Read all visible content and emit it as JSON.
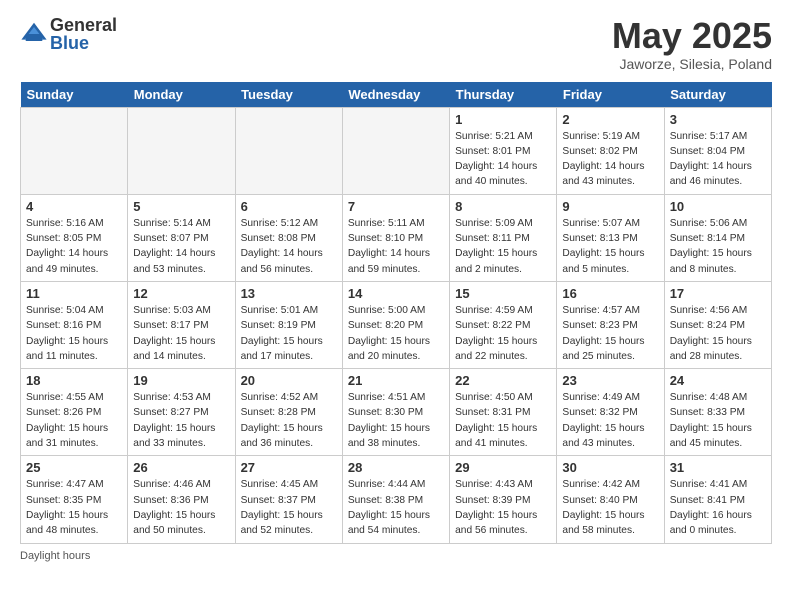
{
  "header": {
    "logo_general": "General",
    "logo_blue": "Blue",
    "month_title": "May 2025",
    "location": "Jaworze, Silesia, Poland"
  },
  "days_of_week": [
    "Sunday",
    "Monday",
    "Tuesday",
    "Wednesday",
    "Thursday",
    "Friday",
    "Saturday"
  ],
  "footer": {
    "note": "Daylight hours"
  },
  "weeks": [
    [
      {
        "day": "",
        "empty": true
      },
      {
        "day": "",
        "empty": true
      },
      {
        "day": "",
        "empty": true
      },
      {
        "day": "",
        "empty": true
      },
      {
        "day": "1",
        "sunrise": "Sunrise: 5:21 AM",
        "sunset": "Sunset: 8:01 PM",
        "daylight": "Daylight: 14 hours and 40 minutes."
      },
      {
        "day": "2",
        "sunrise": "Sunrise: 5:19 AM",
        "sunset": "Sunset: 8:02 PM",
        "daylight": "Daylight: 14 hours and 43 minutes."
      },
      {
        "day": "3",
        "sunrise": "Sunrise: 5:17 AM",
        "sunset": "Sunset: 8:04 PM",
        "daylight": "Daylight: 14 hours and 46 minutes."
      }
    ],
    [
      {
        "day": "4",
        "sunrise": "Sunrise: 5:16 AM",
        "sunset": "Sunset: 8:05 PM",
        "daylight": "Daylight: 14 hours and 49 minutes."
      },
      {
        "day": "5",
        "sunrise": "Sunrise: 5:14 AM",
        "sunset": "Sunset: 8:07 PM",
        "daylight": "Daylight: 14 hours and 53 minutes."
      },
      {
        "day": "6",
        "sunrise": "Sunrise: 5:12 AM",
        "sunset": "Sunset: 8:08 PM",
        "daylight": "Daylight: 14 hours and 56 minutes."
      },
      {
        "day": "7",
        "sunrise": "Sunrise: 5:11 AM",
        "sunset": "Sunset: 8:10 PM",
        "daylight": "Daylight: 14 hours and 59 minutes."
      },
      {
        "day": "8",
        "sunrise": "Sunrise: 5:09 AM",
        "sunset": "Sunset: 8:11 PM",
        "daylight": "Daylight: 15 hours and 2 minutes."
      },
      {
        "day": "9",
        "sunrise": "Sunrise: 5:07 AM",
        "sunset": "Sunset: 8:13 PM",
        "daylight": "Daylight: 15 hours and 5 minutes."
      },
      {
        "day": "10",
        "sunrise": "Sunrise: 5:06 AM",
        "sunset": "Sunset: 8:14 PM",
        "daylight": "Daylight: 15 hours and 8 minutes."
      }
    ],
    [
      {
        "day": "11",
        "sunrise": "Sunrise: 5:04 AM",
        "sunset": "Sunset: 8:16 PM",
        "daylight": "Daylight: 15 hours and 11 minutes."
      },
      {
        "day": "12",
        "sunrise": "Sunrise: 5:03 AM",
        "sunset": "Sunset: 8:17 PM",
        "daylight": "Daylight: 15 hours and 14 minutes."
      },
      {
        "day": "13",
        "sunrise": "Sunrise: 5:01 AM",
        "sunset": "Sunset: 8:19 PM",
        "daylight": "Daylight: 15 hours and 17 minutes."
      },
      {
        "day": "14",
        "sunrise": "Sunrise: 5:00 AM",
        "sunset": "Sunset: 8:20 PM",
        "daylight": "Daylight: 15 hours and 20 minutes."
      },
      {
        "day": "15",
        "sunrise": "Sunrise: 4:59 AM",
        "sunset": "Sunset: 8:22 PM",
        "daylight": "Daylight: 15 hours and 22 minutes."
      },
      {
        "day": "16",
        "sunrise": "Sunrise: 4:57 AM",
        "sunset": "Sunset: 8:23 PM",
        "daylight": "Daylight: 15 hours and 25 minutes."
      },
      {
        "day": "17",
        "sunrise": "Sunrise: 4:56 AM",
        "sunset": "Sunset: 8:24 PM",
        "daylight": "Daylight: 15 hours and 28 minutes."
      }
    ],
    [
      {
        "day": "18",
        "sunrise": "Sunrise: 4:55 AM",
        "sunset": "Sunset: 8:26 PM",
        "daylight": "Daylight: 15 hours and 31 minutes."
      },
      {
        "day": "19",
        "sunrise": "Sunrise: 4:53 AM",
        "sunset": "Sunset: 8:27 PM",
        "daylight": "Daylight: 15 hours and 33 minutes."
      },
      {
        "day": "20",
        "sunrise": "Sunrise: 4:52 AM",
        "sunset": "Sunset: 8:28 PM",
        "daylight": "Daylight: 15 hours and 36 minutes."
      },
      {
        "day": "21",
        "sunrise": "Sunrise: 4:51 AM",
        "sunset": "Sunset: 8:30 PM",
        "daylight": "Daylight: 15 hours and 38 minutes."
      },
      {
        "day": "22",
        "sunrise": "Sunrise: 4:50 AM",
        "sunset": "Sunset: 8:31 PM",
        "daylight": "Daylight: 15 hours and 41 minutes."
      },
      {
        "day": "23",
        "sunrise": "Sunrise: 4:49 AM",
        "sunset": "Sunset: 8:32 PM",
        "daylight": "Daylight: 15 hours and 43 minutes."
      },
      {
        "day": "24",
        "sunrise": "Sunrise: 4:48 AM",
        "sunset": "Sunset: 8:33 PM",
        "daylight": "Daylight: 15 hours and 45 minutes."
      }
    ],
    [
      {
        "day": "25",
        "sunrise": "Sunrise: 4:47 AM",
        "sunset": "Sunset: 8:35 PM",
        "daylight": "Daylight: 15 hours and 48 minutes."
      },
      {
        "day": "26",
        "sunrise": "Sunrise: 4:46 AM",
        "sunset": "Sunset: 8:36 PM",
        "daylight": "Daylight: 15 hours and 50 minutes."
      },
      {
        "day": "27",
        "sunrise": "Sunrise: 4:45 AM",
        "sunset": "Sunset: 8:37 PM",
        "daylight": "Daylight: 15 hours and 52 minutes."
      },
      {
        "day": "28",
        "sunrise": "Sunrise: 4:44 AM",
        "sunset": "Sunset: 8:38 PM",
        "daylight": "Daylight: 15 hours and 54 minutes."
      },
      {
        "day": "29",
        "sunrise": "Sunrise: 4:43 AM",
        "sunset": "Sunset: 8:39 PM",
        "daylight": "Daylight: 15 hours and 56 minutes."
      },
      {
        "day": "30",
        "sunrise": "Sunrise: 4:42 AM",
        "sunset": "Sunset: 8:40 PM",
        "daylight": "Daylight: 15 hours and 58 minutes."
      },
      {
        "day": "31",
        "sunrise": "Sunrise: 4:41 AM",
        "sunset": "Sunset: 8:41 PM",
        "daylight": "Daylight: 16 hours and 0 minutes."
      }
    ]
  ]
}
